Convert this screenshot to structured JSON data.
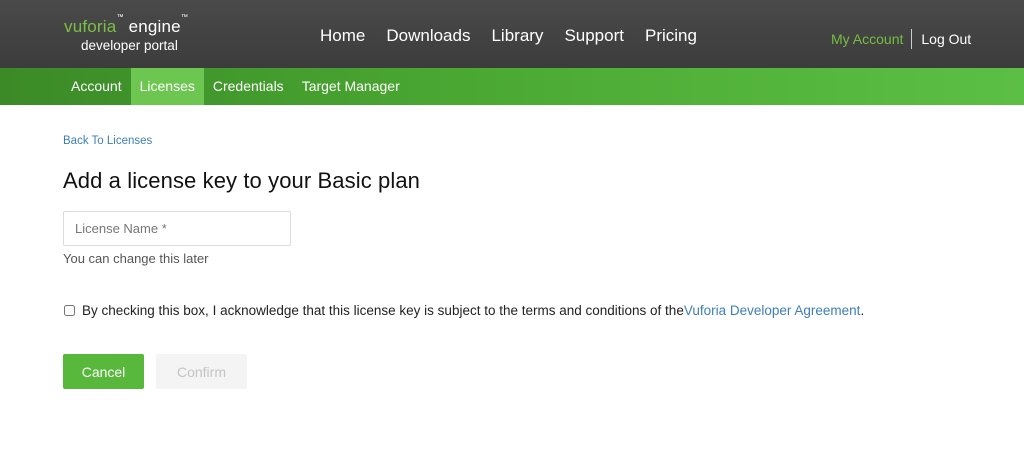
{
  "header": {
    "logo": {
      "brand": "vuforia",
      "product": "engine",
      "mark": "™",
      "subtitle": "developer portal"
    },
    "nav": [
      {
        "label": "Home"
      },
      {
        "label": "Downloads"
      },
      {
        "label": "Library"
      },
      {
        "label": "Support"
      },
      {
        "label": "Pricing"
      }
    ],
    "account": {
      "my_account": "My Account",
      "log_out": "Log Out"
    }
  },
  "subnav": {
    "items": [
      {
        "label": "Account",
        "active": false
      },
      {
        "label": "Licenses",
        "active": true
      },
      {
        "label": "Credentials",
        "active": false
      },
      {
        "label": "Target Manager",
        "active": false
      }
    ]
  },
  "content": {
    "back_link": "Back To Licenses",
    "title": "Add a license key to your Basic plan",
    "license_name": {
      "placeholder": "License Name *",
      "value": "",
      "helper": "You can change this later"
    },
    "agreement": {
      "checked": false,
      "text": "By checking this box, I acknowledge that this license key is subject to the terms and conditions of the ",
      "link": "Vuforia Developer Agreement",
      "end": "."
    },
    "buttons": {
      "cancel": "Cancel",
      "confirm": "Confirm"
    }
  },
  "colors": {
    "header_bg": "#404040",
    "accent_green": "#57b83b",
    "link_blue": "#3d7fb8",
    "my_account_green": "#76bd3f"
  }
}
